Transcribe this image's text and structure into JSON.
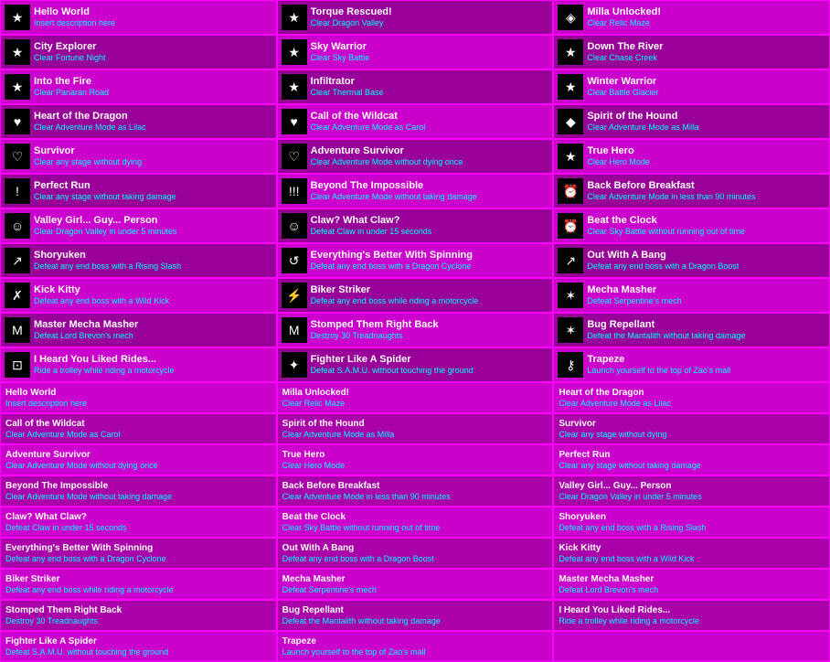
{
  "colors": {
    "bg_primary": "#cc00cc",
    "bg_dark": "#990099",
    "border": "#ff00ff",
    "title": "#ffffff",
    "desc": "#00ffff",
    "icon_bg": "#000000"
  },
  "top_achievements": [
    {
      "icon": "star",
      "title": "Hello World",
      "desc": "Insert description here"
    },
    {
      "icon": "star",
      "title": "Torque Rescued!",
      "desc": "Clear Dragon Valley"
    },
    {
      "icon": "milla",
      "title": "Milla Unlocked!",
      "desc": "Clear Relic Maze"
    },
    {
      "icon": "star",
      "title": "City Explorer",
      "desc": "Clear Fortune Night"
    },
    {
      "icon": "star",
      "title": "Sky Warrior",
      "desc": "Clear Sky Battle"
    },
    {
      "icon": "star",
      "title": "Down The River",
      "desc": "Clear Chase Creek"
    },
    {
      "icon": "star",
      "title": "Into the Fire",
      "desc": "Clear Panaran Road"
    },
    {
      "icon": "star",
      "title": "Infiltrator",
      "desc": "Clear Thermal Base"
    },
    {
      "icon": "star",
      "title": "Winter Warrior",
      "desc": "Clear Battle Glacier"
    },
    {
      "icon": "heart",
      "title": "Heart of the Dragon",
      "desc": "Clear Adventure Mode as Lilac"
    },
    {
      "icon": "heart",
      "title": "Call of the Wildcat",
      "desc": "Clear Adventure Mode as Carol"
    },
    {
      "icon": "dog",
      "title": "Spirit of the Hound",
      "desc": "Clear Adventure Mode as Milla"
    },
    {
      "icon": "heart-outline",
      "title": "Survivor",
      "desc": "Clear any stage without dying"
    },
    {
      "icon": "heart-outline",
      "title": "Adventure Survivor",
      "desc": "Clear Adventure Mode without dying once"
    },
    {
      "icon": "star",
      "title": "True Hero",
      "desc": "Clear Hero Mode"
    },
    {
      "icon": "exclaim",
      "title": "Perfect Run",
      "desc": "Clear any stage without taking damage"
    },
    {
      "icon": "triple-exclaim",
      "title": "Beyond The Impossible",
      "desc": "Clear Adventure Mode without taking damage"
    },
    {
      "icon": "clock",
      "title": "Back Before Breakfast",
      "desc": "Clear Adventure Mode in less than 90 minutes"
    },
    {
      "icon": "person",
      "title": "Valley Girl... Guy... Person",
      "desc": "Clear Dragon Valley in under 5 minutes"
    },
    {
      "icon": "person",
      "title": "Claw? What Claw?",
      "desc": "Defeat Claw in under 15 seconds"
    },
    {
      "icon": "clock",
      "title": "Beat the Clock",
      "desc": "Clear Sky Battle without running out of time"
    },
    {
      "icon": "slash",
      "title": "Shoryuken",
      "desc": "Defeat any end boss with a Rising Slash"
    },
    {
      "icon": "spin",
      "title": "Everything's Better With Spinning",
      "desc": "Defeat any end boss with a Dragon Cyclone"
    },
    {
      "icon": "up-arrow",
      "title": "Out With A Bang",
      "desc": "Defeat any end boss with a Dragon Boost"
    },
    {
      "icon": "kick",
      "title": "Kick Kitty",
      "desc": "Defeat any end boss with a Wild Kick"
    },
    {
      "icon": "bike",
      "title": "Biker Striker",
      "desc": "Defeat any end boss while riding a motorcycle"
    },
    {
      "icon": "bug",
      "title": "Mecha Masher",
      "desc": "Defeat Serpentine's mech"
    },
    {
      "icon": "m",
      "title": "Master Mecha Masher",
      "desc": "Defeat Lord Brevon's mech"
    },
    {
      "icon": "m",
      "title": "Stomped Them Right Back",
      "desc": "Destroy 30 Treadnaughts"
    },
    {
      "icon": "bug",
      "title": "Bug Repellant",
      "desc": "Defeat the Mantalith without taking damage"
    },
    {
      "icon": "trolley",
      "title": "I Heard You Liked Rides...",
      "desc": "Ride a trolley while riding a motorcycle"
    },
    {
      "icon": "spider",
      "title": "Fighter Like A Spider",
      "desc": "Defeat S.A.M.U. without touching the ground"
    },
    {
      "icon": "key",
      "title": "Trapeze",
      "desc": "Launch yourself to the top of Zao's mall"
    }
  ],
  "bottom_list": [
    {
      "col": 0,
      "title": "Hello World",
      "desc": "Insert description here"
    },
    {
      "col": 1,
      "title": "Milla Unlocked!",
      "desc": "Clear Relic Maze"
    },
    {
      "col": 2,
      "title": "Heart of the Dragon",
      "desc": "Clear Adventure Mode as Lilac"
    },
    {
      "col": 0,
      "title": "Call of the Wildcat",
      "desc": "Clear Adventure Mode as Carol"
    },
    {
      "col": 1,
      "title": "Spirit of the Hound",
      "desc": "Clear Adventure Mode as Milla"
    },
    {
      "col": 2,
      "title": "Survivor",
      "desc": "Clear any stage without dying"
    },
    {
      "col": 0,
      "title": "Adventure Survivor",
      "desc": "Clear Adventure Mode without dying once"
    },
    {
      "col": 1,
      "title": "True Hero",
      "desc": "Clear Hero Mode"
    },
    {
      "col": 2,
      "title": "Perfect Run",
      "desc": "Clear any stage without taking damage"
    },
    {
      "col": 0,
      "title": "Beyond The Impossible",
      "desc": "Clear Adventure Mode without taking damage"
    },
    {
      "col": 1,
      "title": "Back Before Breakfast",
      "desc": "Clear Adventure Mode in less than 90 minutes"
    },
    {
      "col": 2,
      "title": "Valley Girl... Guy... Person",
      "desc": "Clear Dragon Valley in under 5 minutes"
    },
    {
      "col": 0,
      "title": "Claw? What Claw?",
      "desc": "Defeat Claw in under 15 seconds"
    },
    {
      "col": 1,
      "title": "Beat the Clock",
      "desc": "Clear Sky Battle without running out of time"
    },
    {
      "col": 2,
      "title": "Shoryuken",
      "desc": "Defeat any end boss with a Rising Slash"
    },
    {
      "col": 0,
      "title": "Everything's Better With Spinning",
      "desc": "Defeat any end boss with a Dragon Cyclone"
    },
    {
      "col": 1,
      "title": "Out With A Bang",
      "desc": "Defeat any end boss with a Dragon Boost"
    },
    {
      "col": 2,
      "title": "Kick Kitty",
      "desc": "Defeat any end boss with a Wild Kick"
    },
    {
      "col": 0,
      "title": "Biker Striker",
      "desc": "Defeat any end boss while riding a motorcycle"
    },
    {
      "col": 1,
      "title": "Mecha Masher",
      "desc": "Defeat Serpentine's mech"
    },
    {
      "col": 2,
      "title": "Master Mecha Masher",
      "desc": "Defeat Lord Brevon's mech"
    },
    {
      "col": 0,
      "title": "Stomped Them Right Back",
      "desc": "Destroy 30 Treadnaughts"
    },
    {
      "col": 1,
      "title": "Bug Repellant",
      "desc": "Defeat the Mantalith without taking damage"
    },
    {
      "col": 2,
      "title": "I Heard You Liked Rides...",
      "desc": "Ride a trolley while riding a motorcycle"
    },
    {
      "col": 0,
      "title": "Fighter Like A Spider",
      "desc": "Defeat S.A.M.U. without touching the ground"
    },
    {
      "col": 1,
      "title": "Trapeze",
      "desc": "Launch yourself to the top of Zao's mall"
    },
    {
      "col": 2,
      "title": "",
      "desc": ""
    }
  ]
}
